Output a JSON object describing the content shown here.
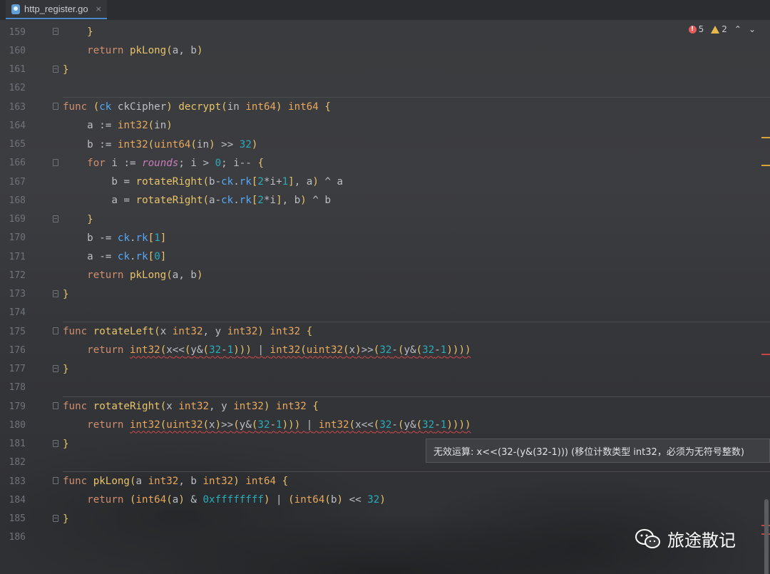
{
  "tab": {
    "filename": "http_register.go",
    "close": "×"
  },
  "status": {
    "errors": "5",
    "warnings": "2",
    "up": "⌃",
    "down": "⌄"
  },
  "tooltip": {
    "text": "无效运算: x<<(32-(y&(32-1))) (移位计数类型 int32，必须为无符号整数)"
  },
  "watermark": {
    "text": "旅途散记"
  },
  "line_numbers": [
    "159",
    "160",
    "161",
    "162",
    "163",
    "164",
    "165",
    "166",
    "167",
    "168",
    "169",
    "170",
    "171",
    "172",
    "173",
    "174",
    "175",
    "176",
    "177",
    "178",
    "179",
    "180",
    "181",
    "182",
    "183",
    "184",
    "185",
    "186"
  ],
  "code_lines": [
    "    }",
    "    return pkLong(a, b)",
    "}",
    "",
    "func (ck ckCipher) decrypt(in int64) int64 {",
    "    a := int32(in)",
    "    b := int32(uint64(in) >> 32)",
    "    for i := rounds; i > 0; i-- {",
    "        b = rotateRight(b-ck.rk[2*i+1], a) ^ a",
    "        a = rotateRight(a-ck.rk[2*i], b) ^ b",
    "    }",
    "    b -= ck.rk[1]",
    "    a -= ck.rk[0]",
    "    return pkLong(a, b)",
    "}",
    "",
    "func rotateLeft(x int32, y int32) int32 {",
    "    return int32(x<<(y&(32-1))) | int32(uint32(x)>>(32-(y&(32-1))))",
    "}",
    "",
    "func rotateRight(x int32, y int32) int32 {",
    "    return int32(uint32(x)>>(y&(32-1))) | int32(x<<(32-(y&(32-1))))",
    "}",
    "",
    "func pkLong(a int32, b int32) int64 {",
    "    return (int64(a) & 0xffffffff) | (int64(b) << 32)",
    "}",
    ""
  ],
  "colors": {
    "keyword": "#cf8e6d",
    "function": "#56a8f5",
    "number": "#2aacb8",
    "error": "#e55c5c",
    "warning": "#e5b84c"
  }
}
